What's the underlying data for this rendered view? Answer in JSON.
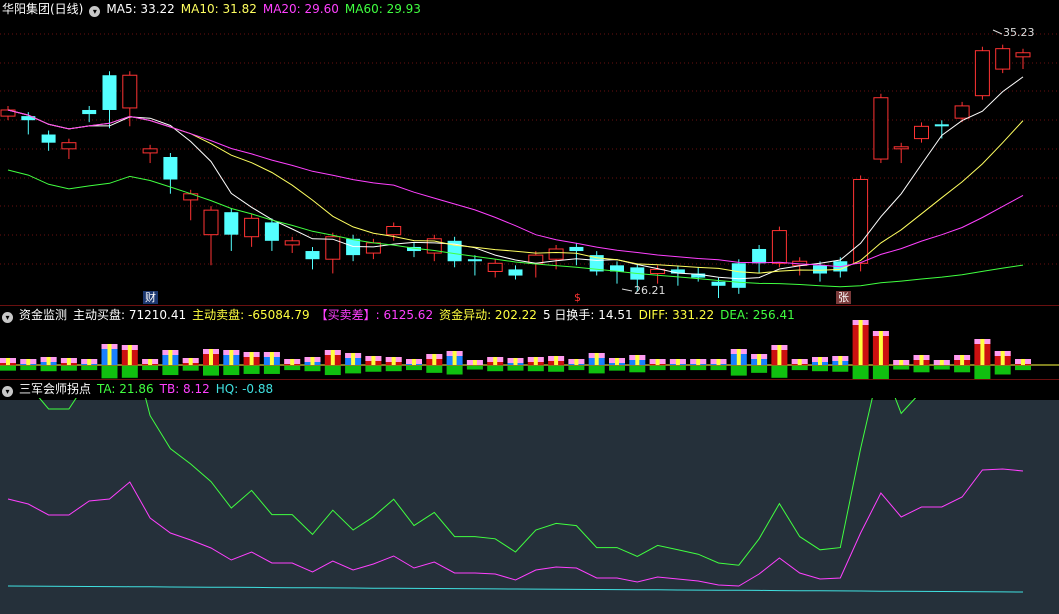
{
  "main": {
    "title": "华阳集团(日线)",
    "ma": [
      {
        "label": "MA5: 33.22",
        "color": "#ffffff"
      },
      {
        "label": "MA10: 31.82",
        "color": "#ffff60"
      },
      {
        "label": "MA20: 29.60",
        "color": "#ff40ff"
      },
      {
        "label": "MA60: 29.93",
        "color": "#40ff40"
      }
    ],
    "high_label": "35.23",
    "low_label": "26.21",
    "tag_cai": "财",
    "tag_s": "$",
    "tag_zhang": "张",
    "candles": [
      [
        18.9,
        19.05,
        18.9,
        19.05
      ],
      [
        18.9,
        18.8,
        18.55,
        18.65
      ],
      [
        18.45,
        18.25,
        18.15,
        18.3
      ],
      [
        18.1,
        18.25,
        17.95,
        18.1
      ],
      [
        19.05,
        18.95,
        18.85,
        19.05
      ],
      [
        19.9,
        19.05,
        18.7,
        19.05
      ],
      [
        19.1,
        19.9,
        18.75,
        19.05
      ],
      [
        18.0,
        18.1,
        17.85,
        17.9
      ],
      [
        17.9,
        17.35,
        17.1,
        17.2
      ],
      [
        16.85,
        17.0,
        16.45,
        16.45
      ],
      [
        16.0,
        16.6,
        15.35,
        16.45
      ],
      [
        16.55,
        16.0,
        15.7,
        15.85
      ],
      [
        15.95,
        16.4,
        15.8,
        15.75
      ],
      [
        16.3,
        15.85,
        15.7,
        15.85
      ],
      [
        15.75,
        15.85,
        15.65,
        15.7
      ],
      [
        15.6,
        15.4,
        15.25,
        15.45
      ],
      [
        15.4,
        15.95,
        15.15,
        15.55
      ],
      [
        15.9,
        15.5,
        15.45,
        15.55
      ],
      [
        15.55,
        15.8,
        15.5,
        15.45
      ],
      [
        16.0,
        16.2,
        15.95,
        15.95
      ],
      [
        15.7,
        15.6,
        15.55,
        15.55
      ],
      [
        15.55,
        15.9,
        15.45,
        15.55
      ],
      [
        15.85,
        15.35,
        15.3,
        15.45
      ],
      [
        15.4,
        15.35,
        15.1,
        15.25
      ],
      [
        15.1,
        15.3,
        15.05,
        15.05
      ],
      [
        15.15,
        15.0,
        15.05,
        15.05
      ],
      [
        15.3,
        15.5,
        15.05,
        15.1
      ],
      [
        15.4,
        15.65,
        15.25,
        15.4
      ],
      [
        15.7,
        15.6,
        15.35,
        15.4
      ],
      [
        15.5,
        15.1,
        15.15,
        15.1
      ],
      [
        15.25,
        15.1,
        14.9,
        15.1
      ],
      [
        15.2,
        14.9,
        14.7,
        15.05
      ],
      [
        15.05,
        15.15,
        14.9,
        15.15
      ],
      [
        15.15,
        15.05,
        14.85,
        14.95
      ],
      [
        15.05,
        14.95,
        14.95,
        15.1
      ],
      [
        14.85,
        14.75,
        14.55,
        14.7
      ],
      [
        15.3,
        14.7,
        14.65,
        14.7
      ],
      [
        15.65,
        15.3,
        15.15,
        15.45
      ],
      [
        15.3,
        16.1,
        15.3,
        16.05
      ],
      [
        15.25,
        15.35,
        15.1,
        15.05
      ],
      [
        15.25,
        15.05,
        14.95,
        15.0
      ],
      [
        15.35,
        15.1,
        15.05,
        15.05
      ],
      [
        15.3,
        17.35,
        15.2,
        17.35
      ],
      [
        17.85,
        19.35,
        18.25,
        18.0
      ],
      [
        18.1,
        18.15,
        17.85,
        17.9
      ],
      [
        18.35,
        18.65,
        18.35,
        18.55
      ],
      [
        18.7,
        18.65,
        18.45,
        18.45
      ],
      [
        18.85,
        19.15,
        19.0,
        18.9
      ],
      [
        19.4,
        20.5,
        19.5,
        19.7
      ],
      [
        20.05,
        20.55,
        20.3,
        20.25
      ],
      [
        20.35,
        20.45,
        20.15,
        20.4
      ]
    ]
  },
  "fund": {
    "title": "资金监测",
    "labels": [
      {
        "text": "主动买盘: 71210.41",
        "color": "#ffffff"
      },
      {
        "text": "主动卖盘: -65084.79",
        "color": "#ffff40"
      },
      {
        "text": "【买卖差】: 6125.62",
        "color": "#ff40ff"
      },
      {
        "text": "资金异动: 202.22",
        "color": "#ffff40"
      },
      {
        "text": "5 日换手: 14.51",
        "color": "#ffffff"
      },
      {
        "text": "DIFF: 331.22",
        "color": "#ffff40"
      },
      {
        "text": "DEA: 256.41",
        "color": "#40ff40"
      }
    ]
  },
  "osc": {
    "title": "三军会师拐点",
    "labels": [
      {
        "text": "TA: 21.86",
        "color": "#40ff40"
      },
      {
        "text": "TB: 8.12",
        "color": "#ff40ff"
      },
      {
        "text": "HQ: -0.88",
        "color": "#40e0e0"
      }
    ]
  },
  "colors": {
    "up": "#ff3333",
    "down": "#54ffff",
    "grid": "#6a1010"
  }
}
